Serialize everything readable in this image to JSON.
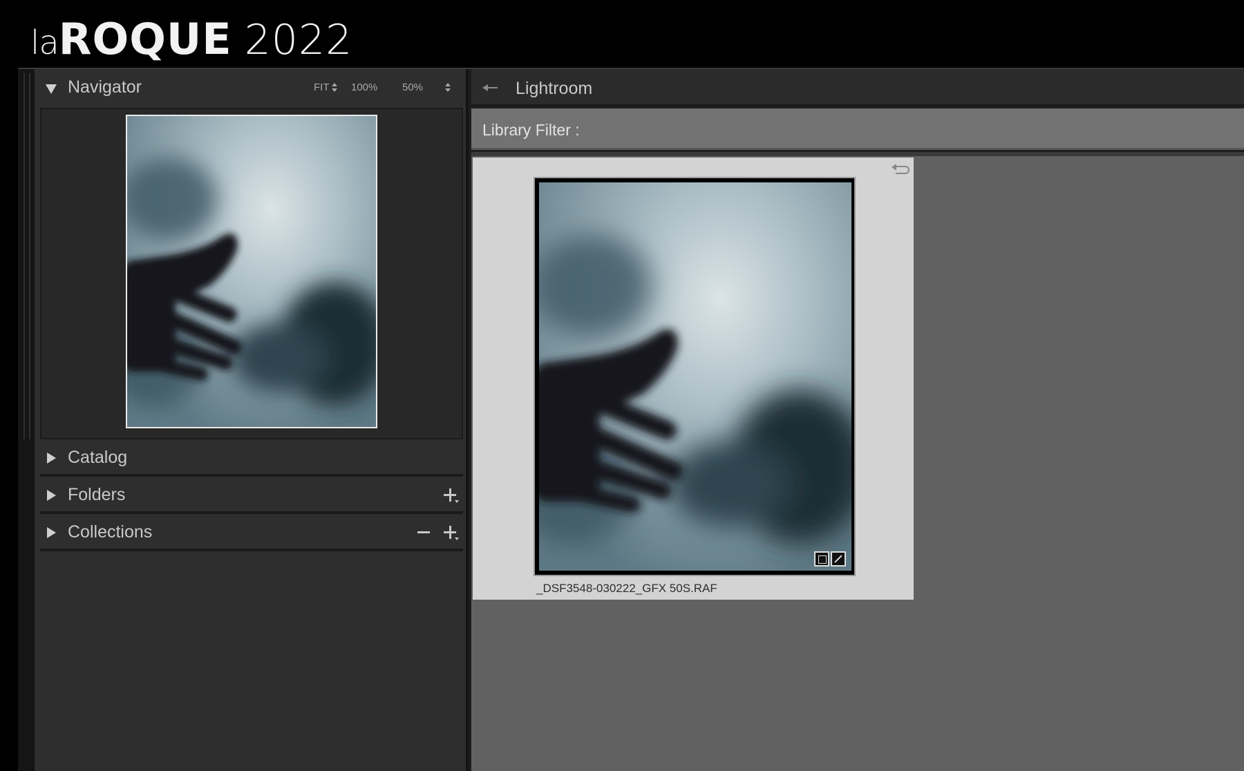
{
  "brand": {
    "la": "la",
    "roque": "ROQUE",
    "year": "2022"
  },
  "navigator": {
    "title": "Navigator",
    "zoom": [
      "FIT",
      "100%",
      "50%"
    ]
  },
  "sections": [
    {
      "label": "Catalog"
    },
    {
      "label": "Folders"
    },
    {
      "label": "Collections"
    }
  ],
  "topbar": {
    "app_label": "Lightroom"
  },
  "filter": {
    "label": "Library Filter :"
  },
  "grid": {
    "cells": [
      {
        "filename": "_DSF3548-030222_GFX 50S.RAF"
      }
    ]
  }
}
